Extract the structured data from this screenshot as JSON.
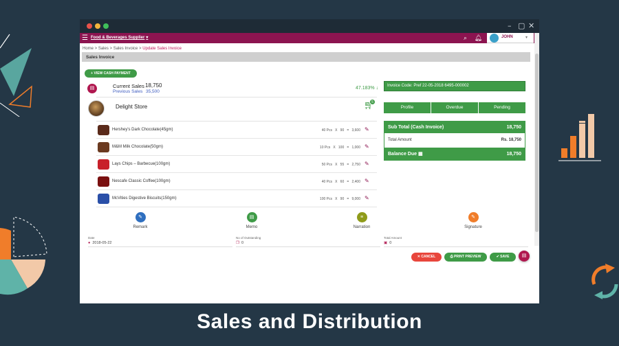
{
  "window": {
    "dot_colors": [
      "#e8524a",
      "#f2b43c",
      "#3fbf5a"
    ],
    "controls": [
      "–",
      "▢",
      "✕"
    ]
  },
  "appbar": {
    "company": "Food & Beverages Supplier",
    "user": "JOHN",
    "bg_color": "#8c1450"
  },
  "breadcrumb": {
    "trail": "Home > Sales > Sales Invoice >",
    "current": "Update Sales Invoice"
  },
  "section_title": "Sales Invoice",
  "view_cash_payment": "+ VIEW CASH PAYMENT",
  "sales": {
    "current_label": "Current Sales",
    "current_value": "18,750",
    "previous_label": "Previous Sales",
    "previous_value": "35,500",
    "growth": "47.183% ↓"
  },
  "store": {
    "name": "Delight Store",
    "cart_count": "5"
  },
  "products": [
    {
      "name": "Hershey's Dark Chocolate(45gm)",
      "calc": "40 Pcs   X   90   =   3,600",
      "img_color": "#5a2a1a"
    },
    {
      "name": "M&M Milk Chocolate(50gm)",
      "calc": "10 Pcs   X   100   =   1,000",
      "img_color": "#6b3a20"
    },
    {
      "name": "Lays Chips – Barbecue(100gm)",
      "calc": "50 Pcs   X   55   =   2,750",
      "img_color": "#c8202a"
    },
    {
      "name": "Nescafe Classic Coffee(100gm)",
      "calc": "40 Pcs   X   60   =   2,400",
      "img_color": "#7a1010"
    },
    {
      "name": "McVities Digestive Biscuits(150gm)",
      "calc": "100 Pcs   X   90   =   9,000",
      "img_color": "#2a4fa8"
    }
  ],
  "invoice_code": "Invoice Code: Pref 22-05-2018 6495-000002",
  "tabs": [
    "Profile",
    "Overdue",
    "Pending"
  ],
  "summary": {
    "subtotal_label": "Sub Total (Cash Invoice)",
    "subtotal_value": "18,750",
    "total_label": "Total Amount",
    "total_value": "Rs. 18,750",
    "balance_label": "Balance Due",
    "balance_value": "18,750"
  },
  "actions": [
    {
      "label": "Remark",
      "color": "#2f6fbf",
      "icon": "✎"
    },
    {
      "label": "Memo",
      "color": "#3f9b47",
      "icon": "▤"
    },
    {
      "label": "Narration",
      "color": "#8f9b1a",
      "icon": "≡"
    },
    {
      "label": "Signature",
      "color": "#f07d2a",
      "icon": "✎"
    }
  ],
  "fields": {
    "date_label": "Date",
    "date_value": "2018-05-22",
    "outstanding_label": "No of Outstanding",
    "outstanding_value": "0",
    "total_amount_label": "Total Amount",
    "total_amount_value": "0"
  },
  "buttons": {
    "cancel": "✕ CANCEL",
    "print_preview": "⎙ PRINT PREVIEW",
    "save": "✔ SAVE"
  },
  "colors": {
    "green": "#3f9b47",
    "red": "#e8463c",
    "magenta": "#b0174f"
  },
  "caption": "Sales and Distribution"
}
